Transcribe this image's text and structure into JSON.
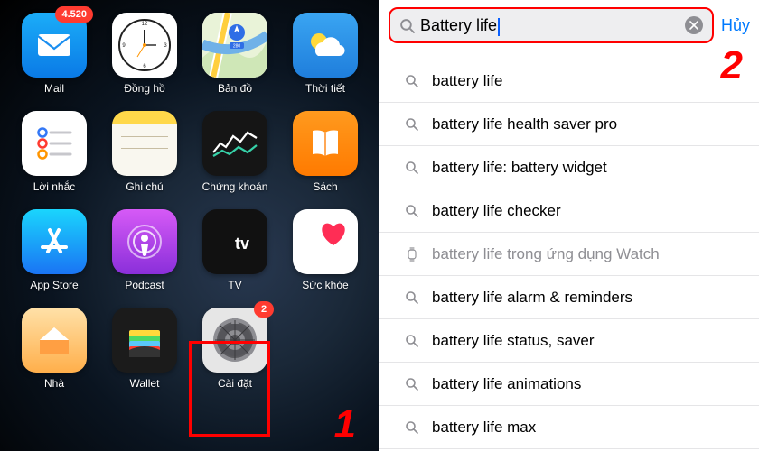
{
  "steps": {
    "one": "1",
    "two": "2"
  },
  "home": {
    "apps": [
      {
        "label": "Mail",
        "badge": "4.520"
      },
      {
        "label": "Đồng hồ"
      },
      {
        "label": "Bản đồ"
      },
      {
        "label": "Thời tiết"
      },
      {
        "label": "Lời nhắc"
      },
      {
        "label": "Ghi chú"
      },
      {
        "label": "Chứng khoán"
      },
      {
        "label": "Sách"
      },
      {
        "label": "App Store"
      },
      {
        "label": "Podcast"
      },
      {
        "label": "TV"
      },
      {
        "label": "Sức khỏe"
      },
      {
        "label": "Nhà"
      },
      {
        "label": "Wallet"
      },
      {
        "label": "Cài đặt",
        "badge": "2"
      }
    ]
  },
  "search": {
    "query": "Battery life",
    "cancel": "Hủy",
    "highlight_term": "battery life",
    "suggestions": [
      {
        "text": "battery life",
        "icon": "search"
      },
      {
        "text": "battery life health saver pro",
        "icon": "search"
      },
      {
        "text": "battery life: battery widget",
        "icon": "search"
      },
      {
        "text": "battery life checker",
        "icon": "search"
      },
      {
        "text": "battery life",
        "suffix": " trong ứng dụng Watch",
        "icon": "watch"
      },
      {
        "text": "battery life alarm & reminders",
        "icon": "search"
      },
      {
        "text": "battery life status, saver",
        "icon": "search"
      },
      {
        "text": "battery life animations",
        "icon": "search"
      },
      {
        "text": "battery life max",
        "icon": "search"
      }
    ]
  }
}
